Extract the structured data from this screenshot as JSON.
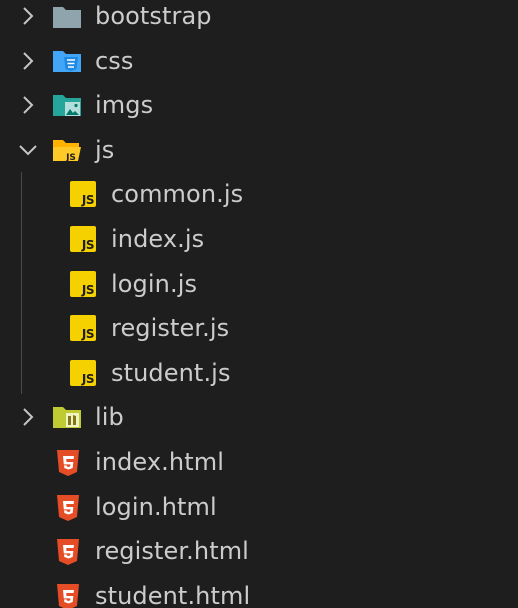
{
  "explorer": {
    "items": [
      {
        "label": "bootstrap",
        "kind": "folder",
        "expanded": false,
        "icon": "folder-icon"
      },
      {
        "label": "css",
        "kind": "folder",
        "expanded": false,
        "icon": "css-folder-icon"
      },
      {
        "label": "imgs",
        "kind": "folder",
        "expanded": false,
        "icon": "images-folder-icon"
      },
      {
        "label": "js",
        "kind": "folder",
        "expanded": true,
        "icon": "js-folder-open-icon"
      },
      {
        "label": "common.js",
        "kind": "file",
        "icon": "javascript-file-icon",
        "badge": "JS"
      },
      {
        "label": "index.js",
        "kind": "file",
        "icon": "javascript-file-icon",
        "badge": "JS"
      },
      {
        "label": "login.js",
        "kind": "file",
        "icon": "javascript-file-icon",
        "badge": "JS"
      },
      {
        "label": "register.js",
        "kind": "file",
        "icon": "javascript-file-icon",
        "badge": "JS"
      },
      {
        "label": "student.js",
        "kind": "file",
        "icon": "javascript-file-icon",
        "badge": "JS"
      },
      {
        "label": "lib",
        "kind": "folder",
        "expanded": false,
        "icon": "library-folder-icon"
      },
      {
        "label": "index.html",
        "kind": "file",
        "icon": "html5-file-icon"
      },
      {
        "label": "login.html",
        "kind": "file",
        "icon": "html5-file-icon"
      },
      {
        "label": "register.html",
        "kind": "file",
        "icon": "html5-file-icon"
      },
      {
        "label": "student.html",
        "kind": "file",
        "icon": "html5-file-icon"
      }
    ]
  },
  "colors": {
    "background": "#1e1e1e",
    "text": "#cccccc",
    "chevron": "#c5c5c5",
    "folder_gray": "#90a4ae",
    "folder_css": "#42a5f5",
    "folder_imgs": "#26a69a",
    "folder_js": "#ffca28",
    "folder_lib": "#c0ca33",
    "js_badge": "#f5d100",
    "html5": "#e44d26"
  }
}
